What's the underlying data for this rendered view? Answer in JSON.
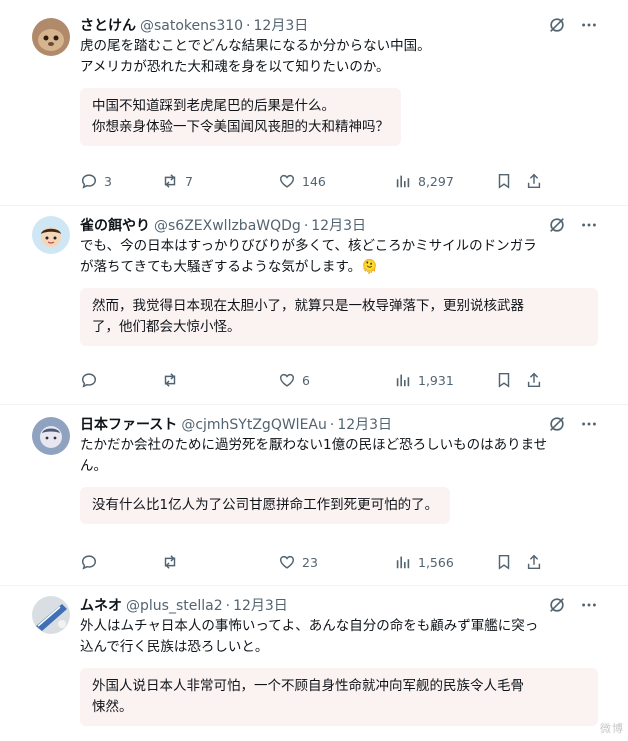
{
  "posts": [
    {
      "name": "さとけん",
      "handle": "@satokens310",
      "date": "12月3日",
      "text_lines": [
        "虎の尾を踏むことでどんな結果になるか分からない中国。",
        "アメリカが恐れた大和魂を身を以て知りたいのか。"
      ],
      "translation_lines": [
        "中国不知道踩到老虎尾巴的后果是什么。",
        "你想亲身体验一下令美国闻风丧胆的大和精神吗？"
      ],
      "replies": "3",
      "reposts": "7",
      "likes": "146",
      "views": "8,297"
    },
    {
      "name": "雀の餌やり",
      "handle": "@s6ZEXwllzbaWQDg",
      "date": "12月3日",
      "text_lines": [
        "でも、今の日本はすっかりびびりが多くて、核どころかミサイルのドンガラ",
        "が落ちてきても大騒ぎするような気がします。🫠"
      ],
      "translation_lines": [
        "然而，我觉得日本现在太胆小了，就算只是一枚导弹落下，更别说核武器",
        "了，他们都会大惊小怪。"
      ],
      "replies": "",
      "reposts": "",
      "likes": "6",
      "views": "1,931"
    },
    {
      "name": "日本ファースト",
      "handle": "@cjmhSYtZgQWlEAu",
      "date": "12月3日",
      "text_lines": [
        "たかだか会社のために過労死を厭わない1億の民ほど恐ろしいものはありませ",
        "ん。"
      ],
      "translation_lines": [
        "没有什么比1亿人为了公司甘愿拼命工作到死更可怕的了。"
      ],
      "replies": "",
      "reposts": "",
      "likes": "23",
      "views": "1,566"
    },
    {
      "name": "ムネオ",
      "handle": "@plus_stella2",
      "date": "12月3日",
      "text_lines": [
        "外人はムチャ日本人の事怖いってよ、あんな自分の命をも顧みず軍艦に突っ",
        "込んで行く民族は恐ろしいと。"
      ],
      "translation_lines": [
        "外国人说日本人非常可怕，一个不顾自身性命就冲向军舰的民族令人毛骨",
        "悚然。"
      ]
    }
  ],
  "separator": "·",
  "watermark": "微博"
}
